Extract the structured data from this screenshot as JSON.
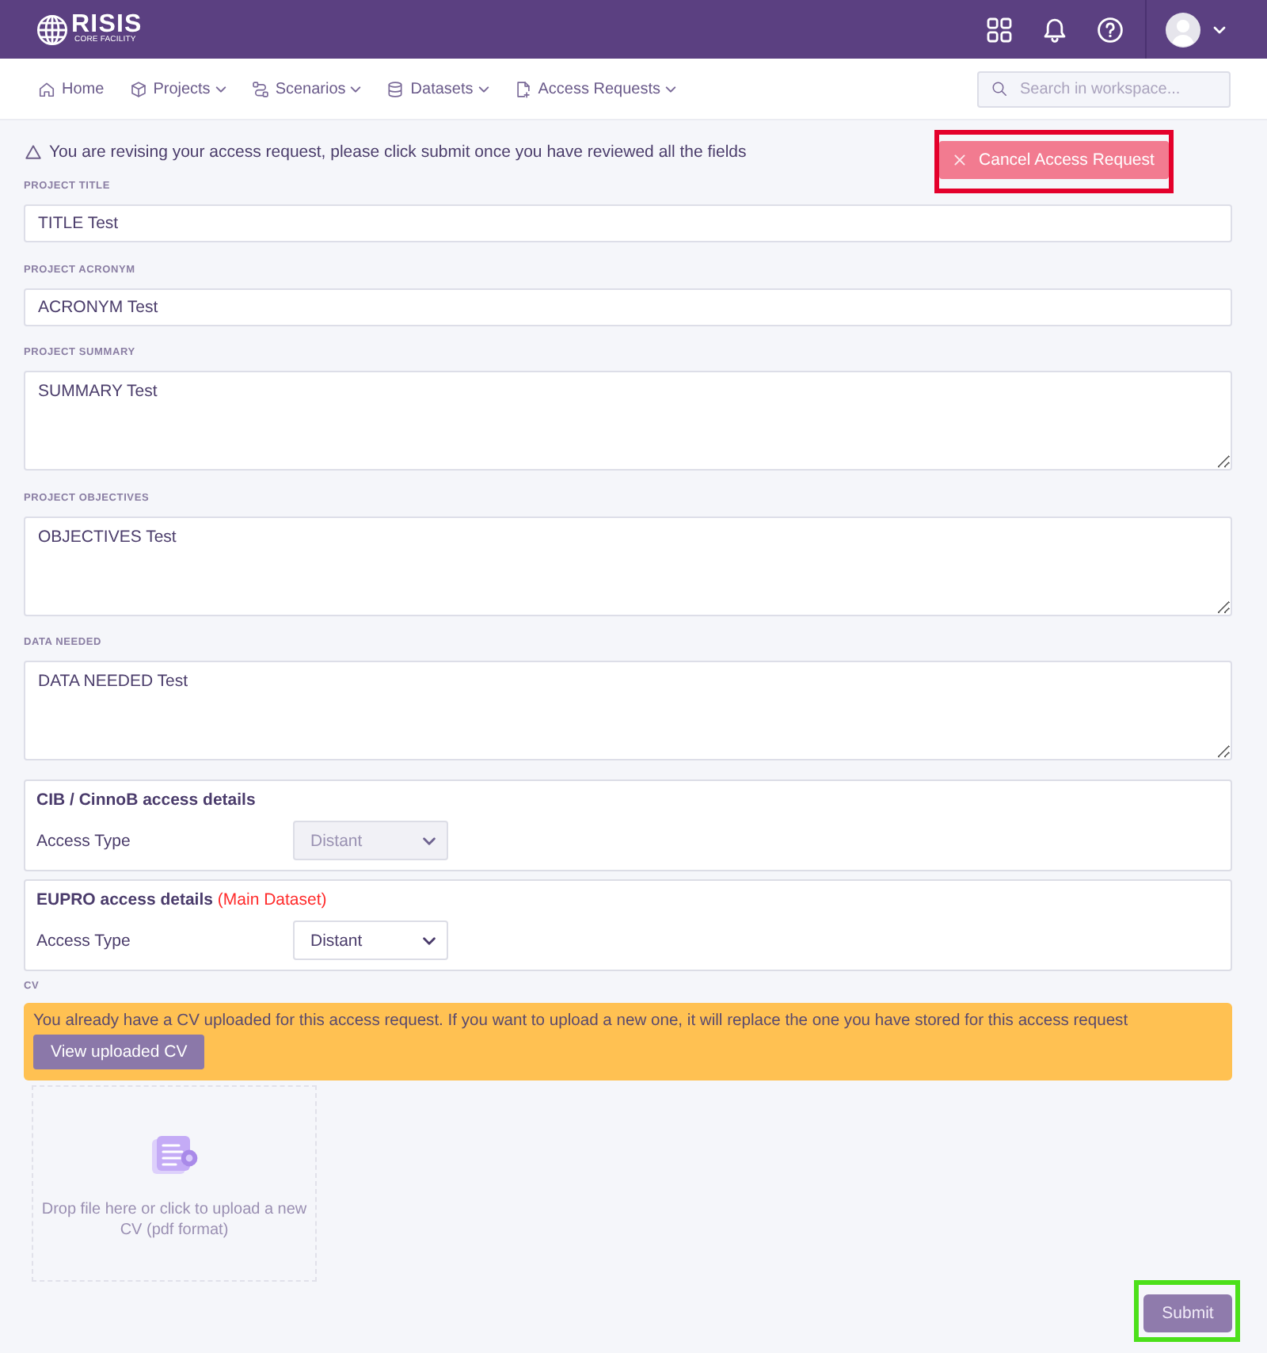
{
  "header": {
    "logo": {
      "name": "RISIS",
      "tagline": "CORE FACILITY"
    }
  },
  "nav": {
    "items": [
      {
        "label": "Home",
        "dropdown": false
      },
      {
        "label": "Projects",
        "dropdown": true
      },
      {
        "label": "Scenarios",
        "dropdown": true
      },
      {
        "label": "Datasets",
        "dropdown": true
      },
      {
        "label": "Access Requests",
        "dropdown": true
      }
    ],
    "search": {
      "placeholder": "Search in workspace..."
    }
  },
  "notice": {
    "text": "You are revising your access request, please click submit once you have reviewed all the fields"
  },
  "cancel_button": {
    "label": "Cancel Access Request",
    "highlight": {
      "color": "#e4002b"
    }
  },
  "fields": [
    {
      "label": "PROJECT TITLE",
      "kind": "input",
      "value": "TITLE Test"
    },
    {
      "label": "PROJECT ACRONYM",
      "kind": "input",
      "value": "ACRONYM Test"
    },
    {
      "label": "PROJECT SUMMARY",
      "kind": "textarea",
      "value": "SUMMARY Test"
    },
    {
      "label": "PROJECT OBJECTIVES",
      "kind": "textarea",
      "value": "OBJECTIVES Test"
    },
    {
      "label": "DATA NEEDED",
      "kind": "textarea",
      "value": "DATA NEEDED Test"
    }
  ],
  "access_details": [
    {
      "title": "CIB / CinnoB access details",
      "field_label": "Access Type",
      "value": "Distant",
      "disabled": true
    },
    {
      "title": "EUPRO access details",
      "note": "(Main Dataset)",
      "field_label": "Access Type",
      "value": "Distant",
      "disabled": false
    }
  ],
  "cv": {
    "label": "CV",
    "alert": {
      "text": "You already have a CV uploaded for this access request. If you want to upload a new one, it will replace the one you have stored for this access request",
      "button": "View uploaded CV"
    },
    "dropzone": {
      "text": "Drop file here or click to upload a new CV (pdf format)"
    }
  },
  "submit_button": {
    "label": "Submit",
    "highlight": {
      "color": "#4ce01a"
    }
  }
}
